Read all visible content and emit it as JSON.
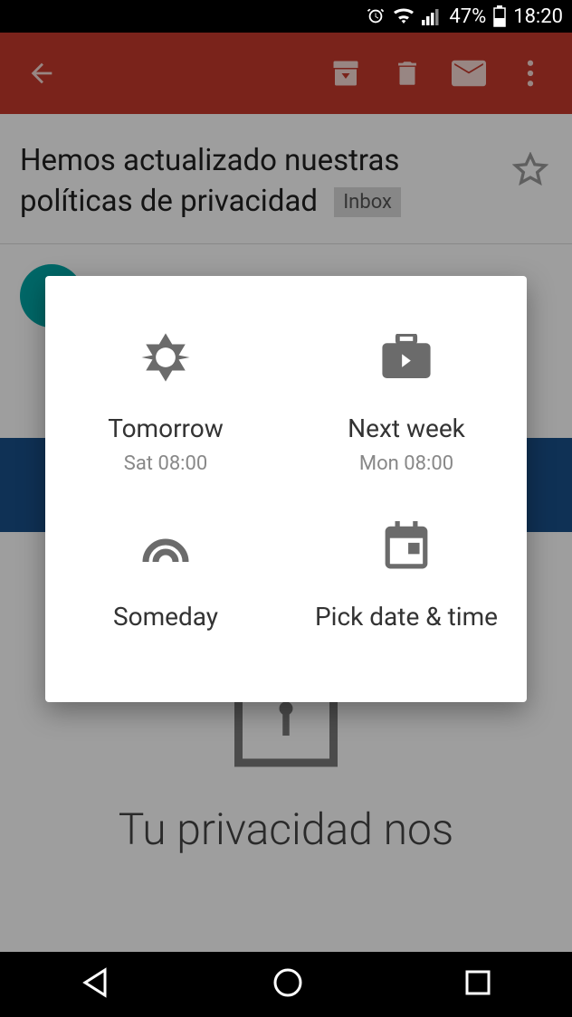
{
  "status": {
    "battery_pct": "47%",
    "time": "18:20"
  },
  "email": {
    "subject": "Hemos actualizado nuestras políticas de privacidad",
    "label": "Inbox",
    "banner_line1": "Tu privacidad nos"
  },
  "dialog": {
    "tomorrow": {
      "title": "Tomorrow",
      "subtitle": "Sat 08:00"
    },
    "nextweek": {
      "title": "Next week",
      "subtitle": "Mon 08:00"
    },
    "someday": {
      "title": "Someday"
    },
    "pick": {
      "title": "Pick date & time"
    }
  }
}
